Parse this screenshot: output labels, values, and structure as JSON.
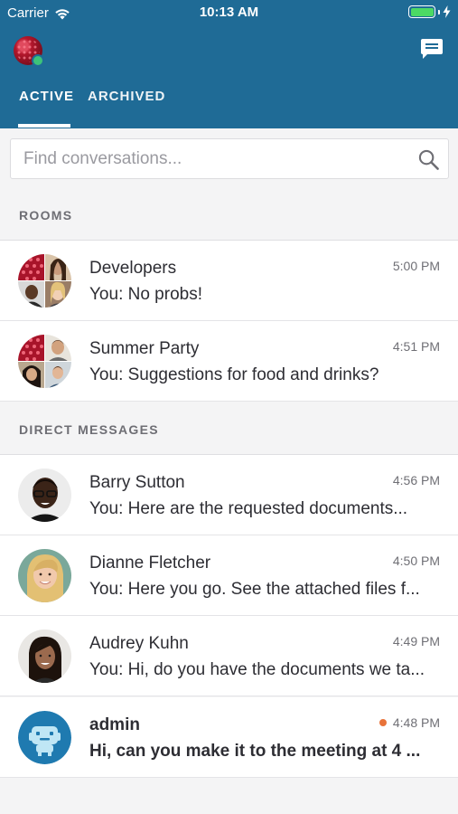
{
  "status_bar": {
    "carrier": "Carrier",
    "time": "10:13 AM"
  },
  "header": {
    "tabs": [
      {
        "label": "ACTIVE",
        "selected": true
      },
      {
        "label": "ARCHIVED",
        "selected": false
      }
    ],
    "accent_color": "#1f6b96"
  },
  "search": {
    "placeholder": "Find conversations..."
  },
  "sections": {
    "rooms": "ROOMS",
    "direct": "DIRECT MESSAGES"
  },
  "rooms": [
    {
      "name": "Developers",
      "time": "5:00 PM",
      "message": "You: No probs!"
    },
    {
      "name": "Summer Party",
      "time": "4:51 PM",
      "message": "You: Suggestions for food and drinks?"
    }
  ],
  "direct_messages": [
    {
      "name": "Barry Sutton",
      "time": "4:56 PM",
      "message": "You: Here are the requested documents...",
      "unread": false
    },
    {
      "name": "Dianne Fletcher",
      "time": "4:50 PM",
      "message": "You: Here you go. See the attached files f...",
      "unread": false
    },
    {
      "name": "Audrey Kuhn",
      "time": "4:49 PM",
      "message": "You: Hi, do you have the documents we ta...",
      "unread": false
    },
    {
      "name": "admin",
      "time": "4:48 PM",
      "message": "Hi, can you make it to the meeting at 4 ...",
      "unread": true
    }
  ],
  "colors": {
    "online": "#3cc37a",
    "unread": "#e8733a"
  }
}
